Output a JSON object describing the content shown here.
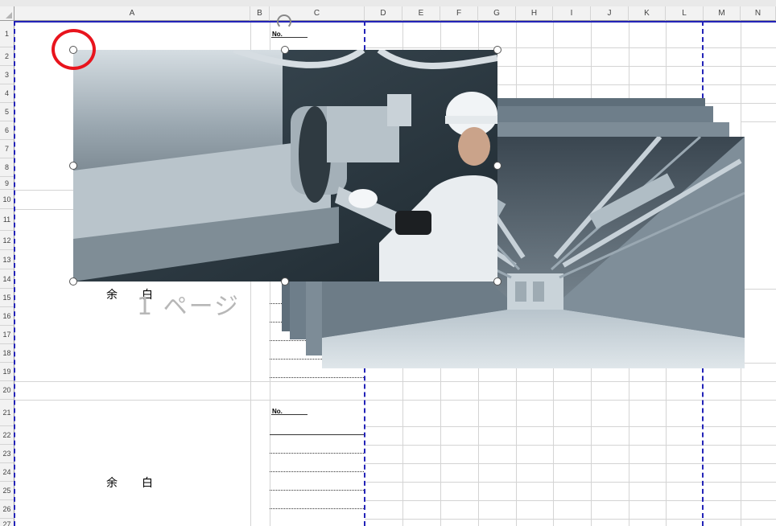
{
  "spreadsheet": {
    "columns": [
      "A",
      "B",
      "C",
      "D",
      "E",
      "F",
      "G",
      "H",
      "I",
      "J",
      "K",
      "L",
      "M",
      "N"
    ],
    "rows": [
      "1",
      "2",
      "3",
      "4",
      "5",
      "6",
      "7",
      "8",
      "9",
      "10",
      "11",
      "12",
      "13",
      "14",
      "15",
      "16",
      "17",
      "18",
      "19",
      "20",
      "21",
      "22",
      "23",
      "24",
      "25",
      "26",
      "27"
    ]
  },
  "cells": {
    "blank_1": "余白",
    "blank_2": "余白",
    "no_label_1": "No.",
    "no_label_2": "No."
  },
  "watermark": {
    "page_label": "1 ページ"
  },
  "colors": {
    "page_break": "#2323b8",
    "highlight_circle": "#e8141d"
  },
  "images": {
    "front_photo_icon": "worker-duct-photo",
    "back_photo_icon": "basement-ducts-photo"
  }
}
